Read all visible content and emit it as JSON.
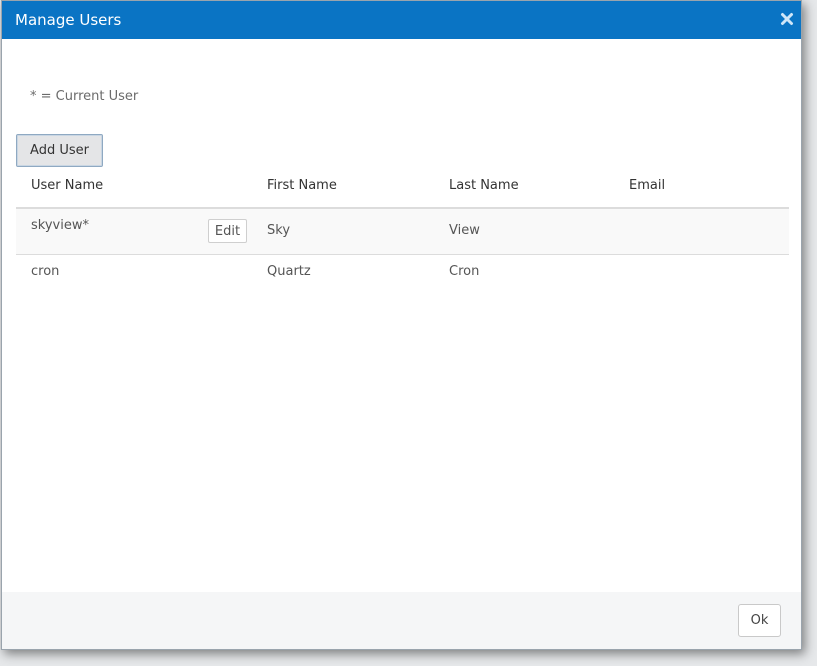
{
  "dialog": {
    "title": "Manage Users",
    "close_icon": "close-icon"
  },
  "note": "* = Current User",
  "toolbar": {
    "add_user_label": "Add User"
  },
  "table": {
    "columns": [
      "User Name",
      "First Name",
      "Last Name",
      "Email"
    ],
    "rows": [
      {
        "user_name": "skyview*",
        "first_name": "Sky",
        "last_name": "View",
        "email": "",
        "edit_label": "Edit"
      },
      {
        "user_name": "cron",
        "first_name": "Quartz",
        "last_name": "Cron",
        "email": ""
      }
    ]
  },
  "footer": {
    "ok_label": "Ok"
  },
  "colors": {
    "titlebar": "#0a74c4",
    "footer": "#f5f6f7"
  }
}
